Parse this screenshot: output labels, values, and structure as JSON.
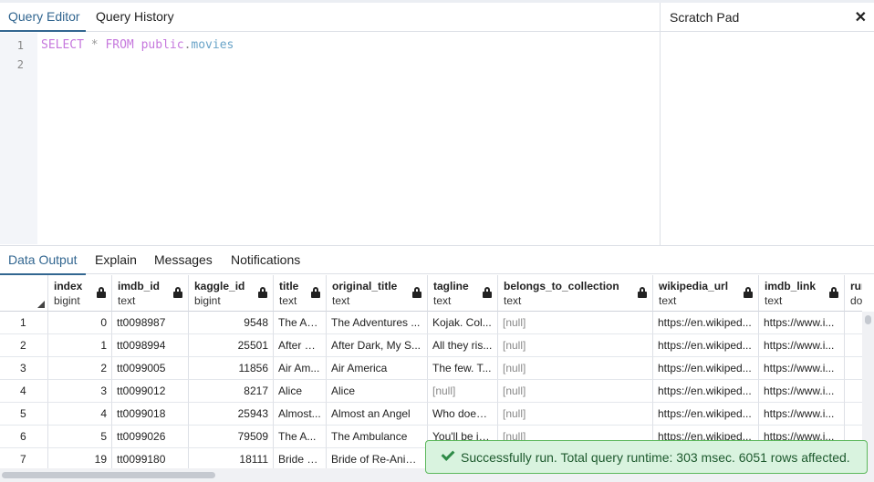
{
  "query_tabs": [
    "Query Editor",
    "Query History"
  ],
  "editor": {
    "line_numbers": [
      "1",
      "2"
    ],
    "sql": {
      "select": "SELECT",
      "star": "*",
      "from": "FROM",
      "schema": "public",
      "dot": ".",
      "table": "movies"
    }
  },
  "scratch_pad": {
    "title": "Scratch Pad",
    "close": "✕"
  },
  "output_tabs": [
    "Data Output",
    "Explain",
    "Messages",
    "Notifications"
  ],
  "grid": {
    "columns": [
      {
        "name": "index",
        "type": "bigint"
      },
      {
        "name": "imdb_id",
        "type": "text"
      },
      {
        "name": "kaggle_id",
        "type": "bigint"
      },
      {
        "name": "title",
        "type": "text"
      },
      {
        "name": "original_title",
        "type": "text"
      },
      {
        "name": "tagline",
        "type": "text"
      },
      {
        "name": "belongs_to_collection",
        "type": "text"
      },
      {
        "name": "wikipedia_url",
        "type": "text"
      },
      {
        "name": "imdb_link",
        "type": "text"
      },
      {
        "name": "runti",
        "type": "doub"
      }
    ],
    "rows": [
      [
        "1",
        "0",
        "tt0098987",
        "9548",
        "The Ad...",
        "The Adventures ...",
        "Kojak. Col...",
        "[null]",
        "https://en.wikiped...",
        "https://www.i..."
      ],
      [
        "2",
        "1",
        "tt0098994",
        "25501",
        "After D...",
        "After Dark, My S...",
        "All they ris...",
        "[null]",
        "https://en.wikiped...",
        "https://www.i..."
      ],
      [
        "3",
        "2",
        "tt0099005",
        "11856",
        "Air Am...",
        "Air America",
        "The few. T...",
        "[null]",
        "https://en.wikiped...",
        "https://www.i..."
      ],
      [
        "4",
        "3",
        "tt0099012",
        "8217",
        "Alice",
        "Alice",
        "[null]",
        "[null]",
        "https://en.wikiped...",
        "https://www.i..."
      ],
      [
        "5",
        "4",
        "tt0099018",
        "25943",
        "Almost...",
        "Almost an Angel",
        "Who does ...",
        "[null]",
        "https://en.wikiped...",
        "https://www.i..."
      ],
      [
        "6",
        "5",
        "tt0099026",
        "79509",
        "The A...",
        "The Ambulance",
        "You'll be in...",
        "[null]",
        "https://en.wikiped...",
        "https://www.i..."
      ],
      [
        "7",
        "19",
        "tt0099180",
        "18111",
        "Bride o...",
        "Bride of Re-Anim...",
        "",
        "",
        "",
        ""
      ]
    ]
  },
  "toast": {
    "message": "Successfully run. Total query runtime: 303 msec. 6051 rows affected."
  },
  "icons": {
    "lock": "lock-icon",
    "check": "check-icon",
    "close": "close-icon",
    "sort": "sort-triangle-icon"
  },
  "colors": {
    "accent": "#326690",
    "toast_bg": "#d9f3df",
    "toast_border": "#5cb85c",
    "keyword": "#c678dd"
  }
}
